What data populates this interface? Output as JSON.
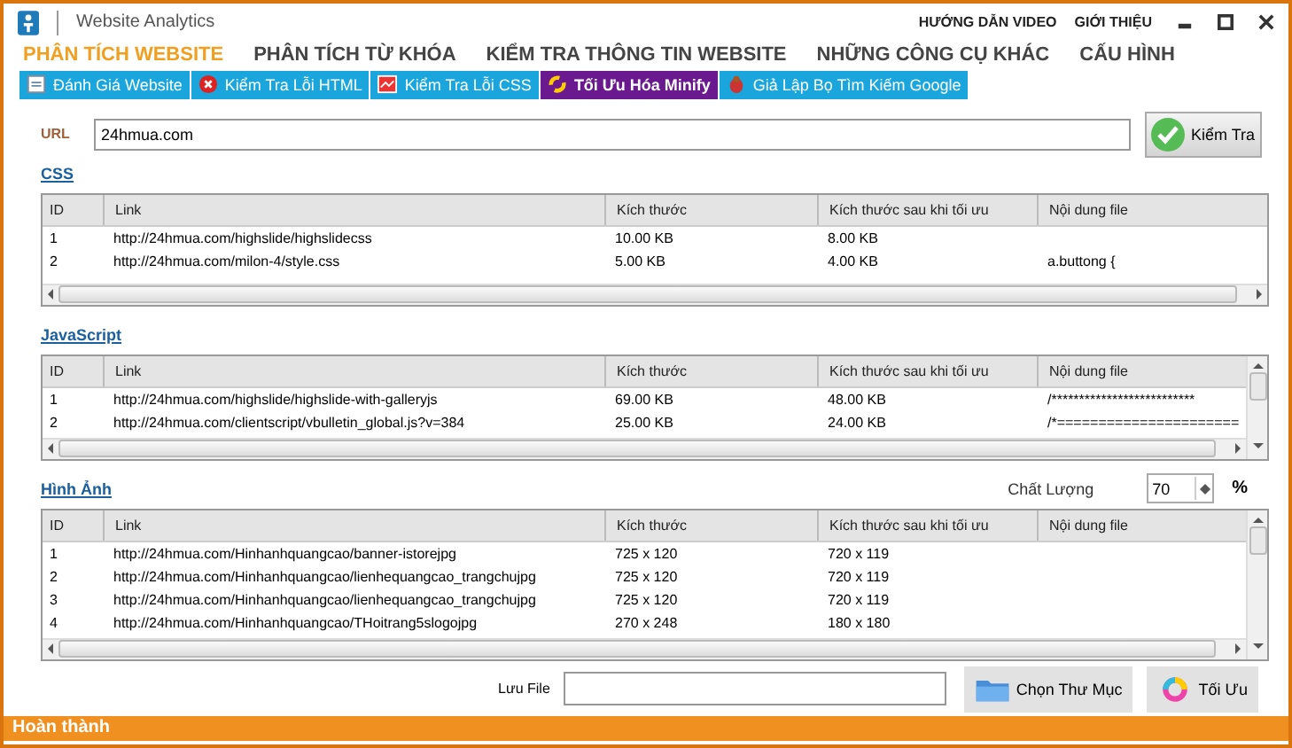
{
  "window": {
    "title": "Website Analytics",
    "links": [
      "HƯỚNG DẪN VIDEO",
      "GIỚI THIỆU"
    ]
  },
  "nav": [
    {
      "label": "PHÂN TÍCH WEBSITE",
      "selected": true
    },
    {
      "label": "PHÂN TÍCH TỪ KHÓA",
      "selected": false
    },
    {
      "label": "KIỂM TRA THÔNG TIN WEBSITE",
      "selected": false
    },
    {
      "label": "NHỮNG CÔNG CỤ KHÁC",
      "selected": false
    },
    {
      "label": "CẤU HÌNH",
      "selected": false
    }
  ],
  "sub_tabs": [
    {
      "label": "Đánh Giá Website",
      "kind": "page",
      "selected": false
    },
    {
      "label": "Kiểm Tra Lỗi HTML",
      "kind": "error",
      "selected": false
    },
    {
      "label": "Kiểm Tra Lỗi CSS",
      "kind": "css",
      "selected": false
    },
    {
      "label": "Tối Ưu Hóa Minify",
      "kind": "ring",
      "selected": true
    },
    {
      "label": "Giả Lập Bọ Tìm Kiếm Google",
      "kind": "bug",
      "selected": false
    }
  ],
  "url": {
    "label": "URL",
    "value": "24hmua.com",
    "button": "Kiểm Tra"
  },
  "css": {
    "title": "CSS",
    "columns": [
      "ID",
      "Link",
      "Kích thước",
      "Kích thước sau khi tối ưu",
      "Nội dung file"
    ],
    "rows": [
      [
        "1",
        "http://24hmua.com/highslide/highslidecss",
        "10.00 KB",
        "8.00 KB",
        ""
      ],
      [
        "2",
        "http://24hmua.com/milon-4/style.css",
        "5.00 KB",
        "4.00 KB",
        "a.buttong {"
      ]
    ]
  },
  "javascript": {
    "title": "JavaScript",
    "columns": [
      "ID",
      "Link",
      "Kích thước",
      "Kích thước sau khi tối ưu",
      "Nội dung file"
    ],
    "rows": [
      [
        "1",
        "http://24hmua.com/highslide/highslide-with-galleryjs",
        "69.00 KB",
        "48.00 KB",
        "/**************************"
      ],
      [
        "2",
        "http://24hmua.com/clientscript/vbulletin_global.js?v=384",
        "25.00 KB",
        "24.00 KB",
        "/*======================"
      ]
    ]
  },
  "images": {
    "title": "Hình Ảnh",
    "quality_label": "Chất Lượng",
    "quality": "70",
    "unit": "%",
    "columns": [
      "ID",
      "Link",
      "Kích thước",
      "Kích thước sau khi tối ưu",
      "Nội dung file"
    ],
    "rows": [
      [
        "1",
        "http://24hmua.com/Hinhanhquangcao/banner-istorejpg",
        "725 x 120",
        "720 x 119",
        ""
      ],
      [
        "2",
        "http://24hmua.com/Hinhanhquangcao/lienhequangcao_trangchujpg",
        "725 x 120",
        "720 x 119",
        ""
      ],
      [
        "3",
        "http://24hmua.com/Hinhanhquangcao/lienhequangcao_trangchujpg",
        "725 x 120",
        "720 x 119",
        ""
      ],
      [
        "4",
        "http://24hmua.com/Hinhanhquangcao/THoitrang5slogojpg",
        "270 x 248",
        "180 x 180",
        ""
      ]
    ]
  },
  "save": {
    "label": "Lưu File",
    "folder_button": "Chọn Thư Mục",
    "optimize_button": "Tối Ưu"
  },
  "status": "Hoàn thành"
}
